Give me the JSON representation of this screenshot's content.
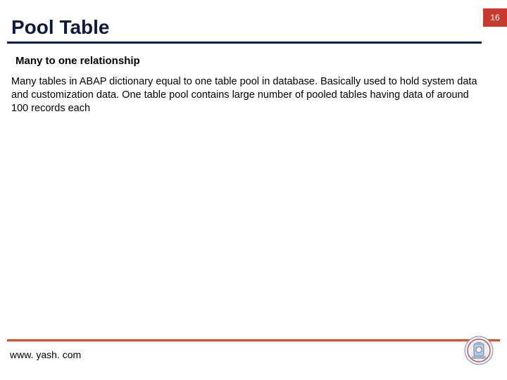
{
  "header": {
    "title": "Pool Table",
    "page_number": "16"
  },
  "content": {
    "subtitle": "Many to one relationship",
    "body": "Many tables in ABAP dictionary equal to one table pool in database. Basically used to hold system data and customization data. One table pool contains large number of pooled tables having data of around 100 records each"
  },
  "footer": {
    "url": "www. yash. com"
  }
}
